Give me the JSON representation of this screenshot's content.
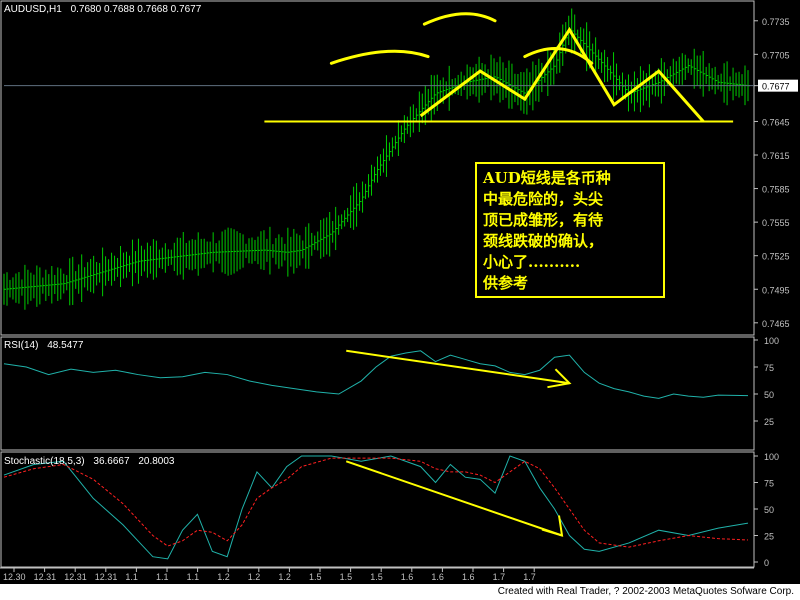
{
  "main": {
    "symbol": "AUDUSD,H1",
    "ohlc": "0.7680 0.7688 0.7668 0.7677",
    "current_price": "0.7677",
    "price_ticks": [
      "0.7735",
      "0.7705",
      "0.7677",
      "0.7645",
      "0.7615",
      "0.7585",
      "0.7555",
      "0.7525",
      "0.7495",
      "0.7465"
    ],
    "annotation": "AUD短线是各币种\n中最危险的，头尖\n顶已成雏形，有待\n颈线跌破的确认，\n小心了..........\n供参考"
  },
  "rsi": {
    "label": "RSI(14)",
    "value": "48.5477",
    "ticks": [
      "100",
      "75",
      "50",
      "25"
    ]
  },
  "stoch": {
    "label": "Stochastic(18,5,3)",
    "main_value": "36.6667",
    "signal_value": "20.8003",
    "ticks": [
      "100",
      "75",
      "50",
      "25",
      "0"
    ]
  },
  "time_labels": [
    "12.30",
    "12.31",
    "12.31",
    "12.31",
    "1.1",
    "1.1",
    "1.1",
    "1.2",
    "1.2",
    "1.2",
    "1.5",
    "1.5",
    "1.5",
    "1.6",
    "1.6",
    "1.6",
    "1.7",
    "1.7"
  ],
  "footer": "Created with Real Trader, ? 2002-2003 MetaQuotes Sofware Corp.",
  "colors": {
    "bars": "#00cc00",
    "rsi": "#20b2aa",
    "stoch_main": "#20b2aa",
    "stoch_signal": "#ff2020",
    "annotation": "#ffff00",
    "axis": "#c0c0c0"
  },
  "chart_data": [
    {
      "type": "bar",
      "name": "price",
      "ylim": [
        0.7455,
        0.775
      ],
      "close_path_x": [
        0,
        8,
        18,
        28,
        35,
        38,
        40,
        44,
        48,
        50,
        54,
        58,
        62,
        66,
        70,
        74,
        76,
        80,
        84,
        88,
        92,
        96,
        100
      ],
      "close_path_y": [
        0.7495,
        0.75,
        0.752,
        0.7528,
        0.753,
        0.7528,
        0.753,
        0.7545,
        0.7575,
        0.76,
        0.764,
        0.767,
        0.768,
        0.7685,
        0.767,
        0.7695,
        0.7728,
        0.77,
        0.767,
        0.768,
        0.7695,
        0.768,
        0.7677
      ],
      "neckline": 0.7645,
      "head_shoulders": [
        [
          56,
          0.765
        ],
        [
          64,
          0.769
        ],
        [
          70,
          0.7665
        ],
        [
          76,
          0.7727
        ],
        [
          82,
          0.766
        ],
        [
          88,
          0.769
        ],
        [
          94,
          0.7645
        ]
      ]
    },
    {
      "type": "line",
      "name": "RSI(14)",
      "ylim": [
        0,
        100
      ],
      "x": [
        0,
        3,
        6,
        9,
        12,
        15,
        18,
        21,
        24,
        27,
        30,
        33,
        36,
        39,
        42,
        45,
        48,
        50,
        52,
        54,
        56,
        58,
        60,
        62,
        64,
        66,
        68,
        70,
        72,
        74,
        76,
        78,
        80,
        82,
        84,
        86,
        88,
        90,
        92,
        94,
        96,
        100
      ],
      "y": [
        78,
        75,
        68,
        73,
        70,
        72,
        68,
        65,
        66,
        70,
        68,
        62,
        58,
        55,
        52,
        50,
        62,
        75,
        85,
        88,
        90,
        80,
        86,
        82,
        78,
        76,
        70,
        68,
        72,
        84,
        86,
        70,
        60,
        55,
        52,
        48,
        46,
        50,
        48,
        47,
        49,
        48.5477
      ],
      "trendline": [
        [
          46,
          90
        ],
        [
          76,
          60
        ]
      ]
    },
    {
      "type": "line",
      "name": "Stochastic(18,5,3)",
      "ylim": [
        0,
        100
      ],
      "x": [
        0,
        4,
        8,
        12,
        16,
        18,
        20,
        22,
        24,
        26,
        28,
        30,
        32,
        34,
        36,
        38,
        40,
        44,
        48,
        52,
        56,
        58,
        60,
        62,
        64,
        66,
        68,
        70,
        72,
        74,
        76,
        78,
        80,
        84,
        88,
        92,
        96,
        100
      ],
      "y": [
        82,
        92,
        95,
        60,
        35,
        20,
        5,
        3,
        30,
        45,
        10,
        5,
        50,
        85,
        70,
        90,
        100,
        100,
        95,
        100,
        90,
        75,
        92,
        80,
        78,
        65,
        100,
        95,
        70,
        50,
        25,
        12,
        10,
        18,
        30,
        25,
        32,
        36.6667
      ],
      "signal": [
        80,
        88,
        92,
        78,
        55,
        40,
        25,
        15,
        20,
        30,
        28,
        20,
        35,
        60,
        70,
        78,
        90,
        98,
        98,
        98,
        95,
        88,
        85,
        85,
        82,
        75,
        85,
        95,
        88,
        70,
        50,
        30,
        18,
        14,
        20,
        25,
        22,
        20.8003
      ],
      "trendline": [
        [
          46,
          95
        ],
        [
          75,
          25
        ]
      ]
    }
  ]
}
